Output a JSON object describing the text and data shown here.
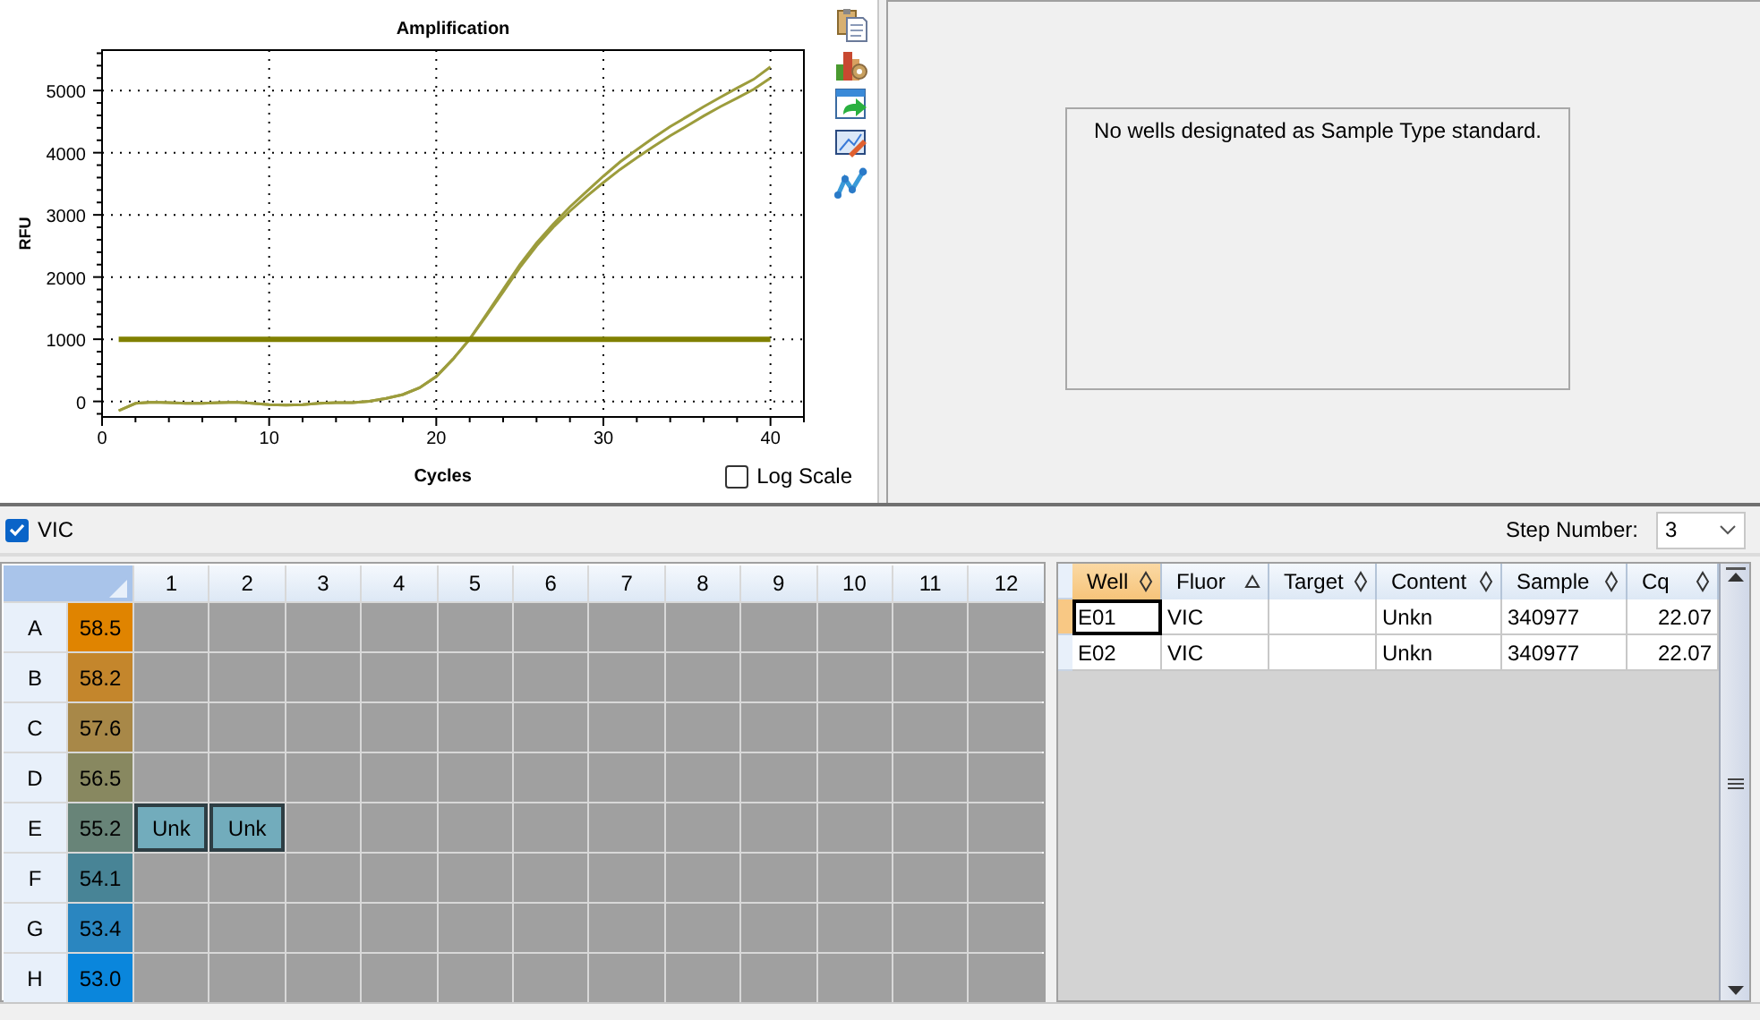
{
  "amplification": {
    "chart_data": {
      "type": "line",
      "title": "Amplification",
      "xlabel": "Cycles",
      "ylabel": "RFU",
      "grid": true,
      "x": [
        1,
        2,
        3,
        4,
        5,
        6,
        7,
        8,
        9,
        10,
        11,
        12,
        13,
        14,
        15,
        16,
        17,
        18,
        19,
        20,
        21,
        22,
        23,
        24,
        25,
        26,
        27,
        28,
        29,
        30,
        31,
        32,
        33,
        34,
        35,
        36,
        37,
        38,
        39,
        40
      ],
      "series": [
        {
          "color": "#9c9c3c",
          "values": [
            -150,
            -30,
            -10,
            -20,
            -30,
            -30,
            -20,
            -10,
            -30,
            -50,
            -60,
            -50,
            -30,
            -20,
            -20,
            0,
            50,
            110,
            220,
            400,
            680,
            1000,
            1400,
            1800,
            2200,
            2550,
            2850,
            3130,
            3380,
            3620,
            3850,
            4050,
            4240,
            4420,
            4580,
            4740,
            4890,
            5040,
            5180,
            5380
          ]
        },
        {
          "color": "#9c9c3c",
          "values": [
            -150,
            -30,
            -10,
            -20,
            -30,
            -30,
            -20,
            -10,
            -30,
            -50,
            -60,
            -50,
            -30,
            -20,
            -20,
            0,
            50,
            110,
            220,
            400,
            680,
            1000,
            1380,
            1760,
            2150,
            2500,
            2800,
            3060,
            3300,
            3520,
            3730,
            3920,
            4100,
            4270,
            4430,
            4590,
            4740,
            4880,
            5020,
            5200
          ]
        },
        {
          "color": "#808000",
          "values": [
            1000,
            1000,
            1000,
            1000,
            1000,
            1000,
            1000,
            1000,
            1000,
            1000,
            1000,
            1000,
            1000,
            1000,
            1000,
            1000,
            1000,
            1000,
            1000,
            1000,
            1000,
            1000,
            1000,
            1000,
            1000,
            1000,
            1000,
            1000,
            1000,
            1000,
            1000,
            1000,
            1000,
            1000,
            1000,
            1000,
            1000,
            1000,
            1000,
            1000
          ]
        }
      ],
      "xlim": [
        0,
        42
      ],
      "ylim": [
        -250,
        5650
      ],
      "xticks": [
        0,
        10,
        20,
        30,
        40
      ],
      "yticks": [
        0,
        1000,
        2000,
        3000,
        4000,
        5000
      ]
    },
    "log_scale": {
      "label": "Log Scale",
      "checked": false
    }
  },
  "standard_curve": {
    "message": "No wells designated as Sample Type standard."
  },
  "fluor_filter": {
    "label": "VIC",
    "checked": true
  },
  "step_number": {
    "label": "Step Number:",
    "value": "3"
  },
  "plate": {
    "columns": [
      "1",
      "2",
      "3",
      "4",
      "5",
      "6",
      "7",
      "8",
      "9",
      "10",
      "11",
      "12"
    ],
    "rows": [
      {
        "label": "A",
        "temperature": "58.5",
        "color": "#e08400",
        "wells": [
          {
            "kind": "empty"
          },
          {
            "kind": "empty"
          },
          {
            "kind": "empty"
          },
          {
            "kind": "empty"
          },
          {
            "kind": "empty"
          },
          {
            "kind": "empty"
          },
          {
            "kind": "empty"
          },
          {
            "kind": "empty"
          },
          {
            "kind": "empty"
          },
          {
            "kind": "empty"
          },
          {
            "kind": "empty"
          },
          {
            "kind": "empty"
          }
        ]
      },
      {
        "label": "B",
        "temperature": "58.2",
        "color": "#c4862c",
        "wells": [
          {
            "kind": "empty"
          },
          {
            "kind": "empty"
          },
          {
            "kind": "empty"
          },
          {
            "kind": "empty"
          },
          {
            "kind": "empty"
          },
          {
            "kind": "empty"
          },
          {
            "kind": "empty"
          },
          {
            "kind": "empty"
          },
          {
            "kind": "empty"
          },
          {
            "kind": "empty"
          },
          {
            "kind": "empty"
          },
          {
            "kind": "empty"
          }
        ]
      },
      {
        "label": "C",
        "temperature": "57.6",
        "color": "#a88848",
        "wells": [
          {
            "kind": "empty"
          },
          {
            "kind": "empty"
          },
          {
            "kind": "empty"
          },
          {
            "kind": "empty"
          },
          {
            "kind": "empty"
          },
          {
            "kind": "empty"
          },
          {
            "kind": "empty"
          },
          {
            "kind": "empty"
          },
          {
            "kind": "empty"
          },
          {
            "kind": "empty"
          },
          {
            "kind": "empty"
          },
          {
            "kind": "empty"
          }
        ]
      },
      {
        "label": "D",
        "temperature": "56.5",
        "color": "#888860",
        "wells": [
          {
            "kind": "empty"
          },
          {
            "kind": "empty"
          },
          {
            "kind": "empty"
          },
          {
            "kind": "empty"
          },
          {
            "kind": "empty"
          },
          {
            "kind": "empty"
          },
          {
            "kind": "empty"
          },
          {
            "kind": "empty"
          },
          {
            "kind": "empty"
          },
          {
            "kind": "empty"
          },
          {
            "kind": "empty"
          },
          {
            "kind": "empty"
          }
        ]
      },
      {
        "label": "E",
        "temperature": "55.2",
        "color": "#688478",
        "wells": [
          {
            "kind": "sample",
            "label": "Unk"
          },
          {
            "kind": "sample",
            "label": "Unk"
          },
          {
            "kind": "empty"
          },
          {
            "kind": "empty"
          },
          {
            "kind": "empty"
          },
          {
            "kind": "empty"
          },
          {
            "kind": "empty"
          },
          {
            "kind": "empty"
          },
          {
            "kind": "empty"
          },
          {
            "kind": "empty"
          },
          {
            "kind": "empty"
          },
          {
            "kind": "empty"
          }
        ]
      },
      {
        "label": "F",
        "temperature": "54.1",
        "color": "#488496",
        "wells": [
          {
            "kind": "empty"
          },
          {
            "kind": "empty"
          },
          {
            "kind": "empty"
          },
          {
            "kind": "empty"
          },
          {
            "kind": "empty"
          },
          {
            "kind": "empty"
          },
          {
            "kind": "empty"
          },
          {
            "kind": "empty"
          },
          {
            "kind": "empty"
          },
          {
            "kind": "empty"
          },
          {
            "kind": "empty"
          },
          {
            "kind": "empty"
          }
        ]
      },
      {
        "label": "G",
        "temperature": "53.4",
        "color": "#2a86c0",
        "wells": [
          {
            "kind": "empty"
          },
          {
            "kind": "empty"
          },
          {
            "kind": "empty"
          },
          {
            "kind": "empty"
          },
          {
            "kind": "empty"
          },
          {
            "kind": "empty"
          },
          {
            "kind": "empty"
          },
          {
            "kind": "empty"
          },
          {
            "kind": "empty"
          },
          {
            "kind": "empty"
          },
          {
            "kind": "empty"
          },
          {
            "kind": "empty"
          }
        ]
      },
      {
        "label": "H",
        "temperature": "53.0",
        "color": "#0a86dc",
        "wells": [
          {
            "kind": "empty"
          },
          {
            "kind": "empty"
          },
          {
            "kind": "empty"
          },
          {
            "kind": "empty"
          },
          {
            "kind": "empty"
          },
          {
            "kind": "empty"
          },
          {
            "kind": "empty"
          },
          {
            "kind": "empty"
          },
          {
            "kind": "empty"
          },
          {
            "kind": "empty"
          },
          {
            "kind": "empty"
          },
          {
            "kind": "empty"
          }
        ]
      }
    ]
  },
  "results_table": {
    "columns": [
      {
        "label": "Well",
        "sorted_ascending": false,
        "selected": true
      },
      {
        "label": "Fluor",
        "sorted_ascending": true,
        "selected": false
      },
      {
        "label": "Target",
        "sorted_ascending": false,
        "selected": false
      },
      {
        "label": "Content",
        "sorted_ascending": false,
        "selected": false
      },
      {
        "label": "Sample",
        "sorted_ascending": false,
        "selected": false
      },
      {
        "label": "Cq",
        "sorted_ascending": false,
        "selected": false
      }
    ],
    "rows": [
      {
        "selected": true,
        "well": "E01",
        "fluor": "VIC",
        "content": "Unkn",
        "sample": "340977",
        "cq": "22.07"
      },
      {
        "selected": false,
        "well": "E02",
        "fluor": "VIC",
        "content": "Unkn",
        "sample": "340977",
        "cq": "22.07"
      }
    ]
  }
}
